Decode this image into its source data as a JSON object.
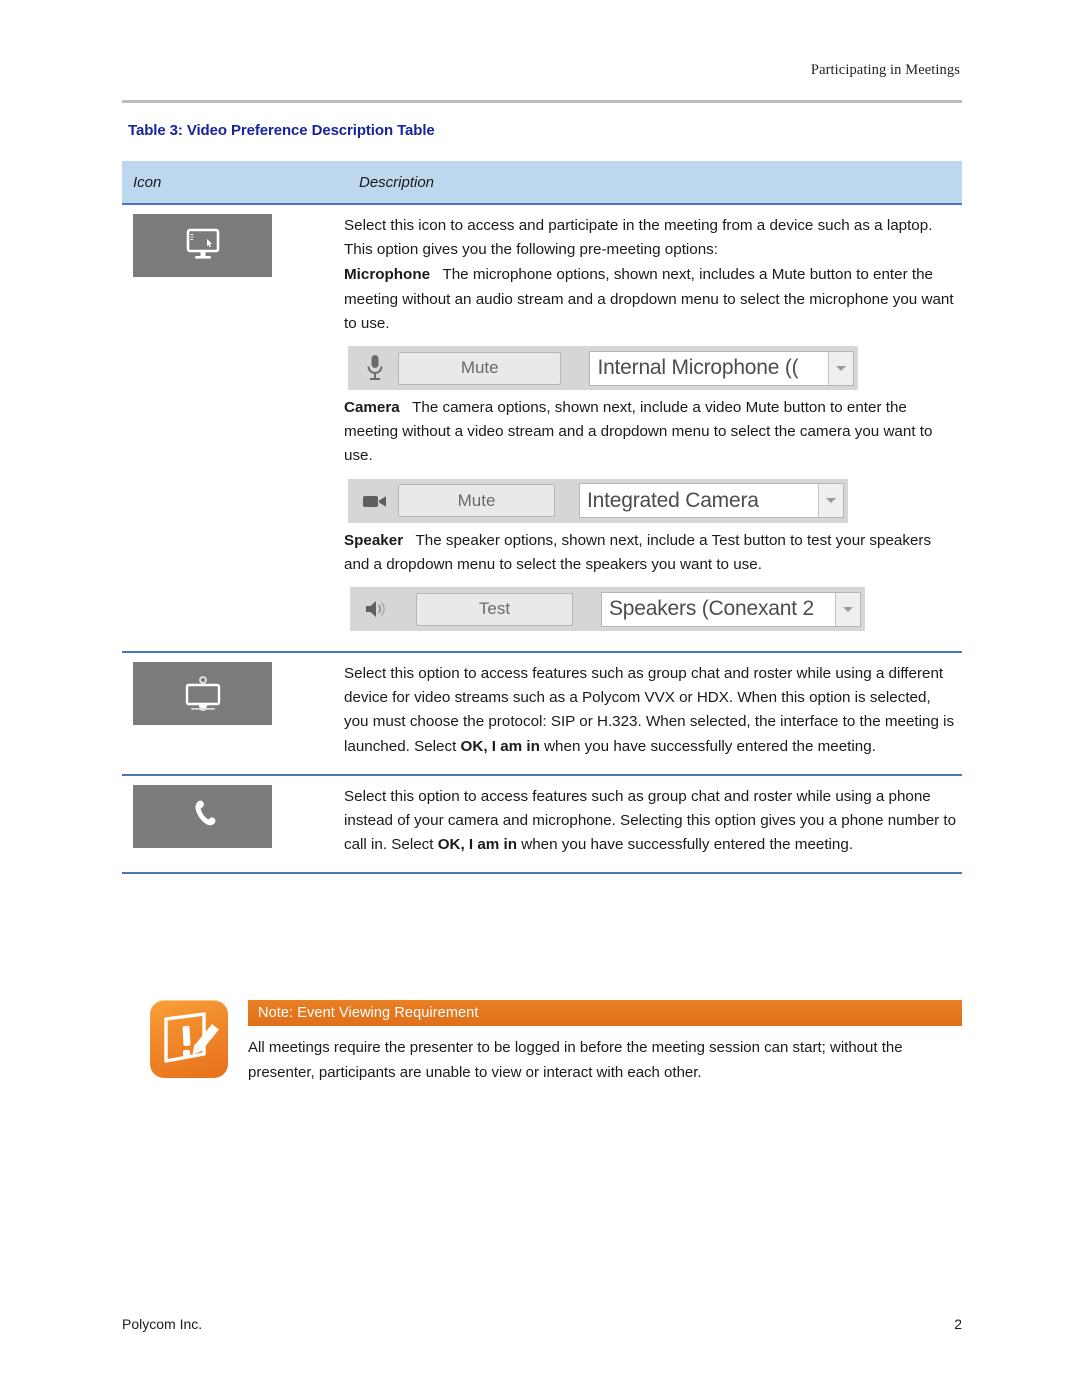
{
  "header": {
    "running_head": "Participating in Meetings"
  },
  "table": {
    "caption": "Table 3: Video Preference Description Table",
    "columns": {
      "icon": "Icon",
      "description": "Description"
    },
    "rows": [
      {
        "icon_name": "desktop-monitor-icon",
        "paragraphs": [
          {
            "text": "Select this icon to access and participate in the meeting from a device such as a laptop. This option gives you the following pre-meeting options:"
          },
          {
            "lead_in": "Microphone",
            "text": "The microphone options, shown next, includes a Mute button to enter the meeting without an audio stream and a dropdown menu to select the microphone you want to use."
          },
          {
            "lead_in": "Camera",
            "text": "The camera options, shown next, include a video Mute button to enter the meeting without a video stream and a dropdown menu to select the camera you want to use."
          },
          {
            "lead_in": "Speaker",
            "text": "The speaker options, shown next, include a Test button to test your speakers and a dropdown menu to select the speakers you want to use."
          }
        ],
        "widgets": {
          "microphone": {
            "icon_name": "microphone-icon",
            "button_label": "Mute",
            "combo_value": "Internal Microphone (("
          },
          "camera": {
            "icon_name": "video-camera-icon",
            "button_label": "Mute",
            "combo_value": "Integrated Camera"
          },
          "speaker": {
            "icon_name": "speaker-volume-icon",
            "button_label": "Test",
            "combo_value": "Speakers (Conexant 2"
          }
        }
      },
      {
        "icon_name": "video-endpoint-icon",
        "text_part_1": "Select this option to access features such as group chat and roster while using a different device for video streams such as a Polycom VVX or HDX. When this option is selected, you must choose the protocol: SIP or H.323. When selected, the interface to the meeting is launched. Select ",
        "bold_phrase": "OK, I am in",
        "text_part_2": " when you have successfully entered the meeting."
      },
      {
        "icon_name": "phone-handset-icon",
        "text_part_1": "Select this option to access features such as group chat and roster while using a phone instead of your camera and microphone. Selecting this option gives you a phone number to call in. Select ",
        "bold_phrase": "OK, I am in",
        "text_part_2": " when you have successfully entered the meeting."
      }
    ]
  },
  "note": {
    "icon_name": "note-warning-icon",
    "title": "Note: Event Viewing Requirement",
    "body": "All meetings require the presenter to be logged in before the meeting session can start; without the presenter, participants are unable to view or interact with each other."
  },
  "footer": {
    "company": "Polycom Inc.",
    "page_number": "2"
  },
  "colors": {
    "caption_blue": "#18239c",
    "table_header_fill": "#bdd7ee",
    "table_rule_blue": "#4a77bb",
    "icon_tile_gray": "#7b7b7b",
    "note_orange": "#e0701a"
  }
}
